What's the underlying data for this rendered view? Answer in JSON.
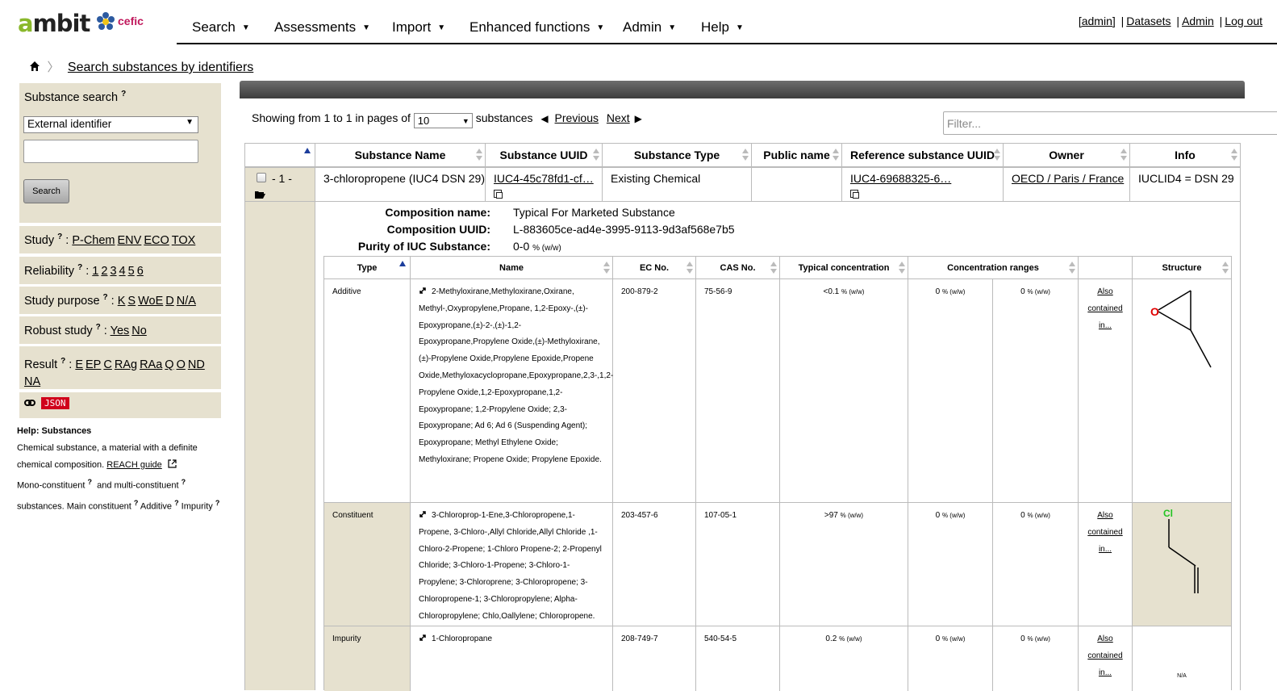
{
  "header": {
    "logo_text": "ambit",
    "logo_sub": "cefic",
    "nav": [
      "Search",
      "Assessments",
      "Import",
      "Enhanced functions",
      "Admin",
      "Help"
    ],
    "user_links": {
      "user": "[admin]",
      "datasets": "Datasets",
      "admin": "Admin",
      "logout": "Log out"
    }
  },
  "breadcrumb": {
    "current": "Search substances by identifiers"
  },
  "sidebar": {
    "search_title": "Substance search",
    "help_mark": "?",
    "select_value": "External identifier",
    "input_value": "",
    "search_button": "Search",
    "study_label": "Study",
    "study_links": [
      "P-Chem",
      "ENV",
      "ECO",
      "TOX"
    ],
    "reliability_label": "Reliability",
    "reliability_links": [
      "1",
      "2",
      "3",
      "4",
      "5",
      "6"
    ],
    "purpose_label": "Study purpose",
    "purpose_links": [
      "K",
      "S",
      "WoE",
      "D",
      "N/A"
    ],
    "robust_label": "Robust study",
    "robust_links": [
      "Yes",
      "No"
    ],
    "result_label": "Result",
    "result_links": [
      "E",
      "EP",
      "C",
      "RAg",
      "RAa",
      "Q",
      "O",
      "ND",
      "NA"
    ],
    "json_badge": "JSON"
  },
  "help": {
    "title": "Help: Substances",
    "line1": "Chemical substance, a material with a definite",
    "line2": "chemical composition.",
    "reach_link": "REACH guide",
    "line3a": "Mono-constituent",
    "line3b": "and multi-constituent",
    "line4a": "substances. Main constituent",
    "line4b": "Additive",
    "line4c": "Impurity"
  },
  "pager": {
    "showing": "Showing from 1 to 1 in pages of",
    "page_size": "10",
    "unit": "substances",
    "previous": "Previous",
    "next": "Next",
    "filter_placeholder": "Filter..."
  },
  "table": {
    "headers": [
      "Substance Name",
      "Substance UUID",
      "Substance Type",
      "Public name",
      "Reference substance UUID",
      "Owner",
      "Info"
    ],
    "row": {
      "index": "- 1 -",
      "name": "3-chloropropene (IUC4 DSN 29)",
      "uuid": "IUC4-45c78fd1-cf…",
      "type": "Existing Chemical",
      "public_name": "",
      "ref_uuid": "IUC4-69688325-6…",
      "owner": "OECD / Paris / France",
      "info": "IUCLID4 = DSN 29"
    }
  },
  "composition": {
    "name_label": "Composition name:",
    "name": "Typical For Marketed Substance",
    "uuid_label": "Composition UUID:",
    "uuid": "L-883605ce-ad4e-3995-9113-9d3af568e7b5",
    "purity_label": "Purity of IUC Substance:",
    "purity": "0-0",
    "purity_unit": "% (w/w)"
  },
  "subtable": {
    "headers": [
      "Type",
      "Name",
      "EC No.",
      "CAS No.",
      "Typical concentration",
      "Concentration ranges",
      "",
      "Structure"
    ],
    "rows": [
      {
        "type": "Additive",
        "name": "2-Methyloxirane,Methyloxirane,Oxirane, Methyl-,Oxypropylene,Propane, 1,2-Epoxy-,(±)-Epoxypropane,(±)-2-,(±)-1,2-Epoxypropane,Propylene Oxide,(±)-Methyloxirane,(±)-Propylene Oxide,Propylene Epoxide,Propene Oxide,Methyloxacyclopropane,Epoxypropane,2,3-,1,2-Propylene Oxide,1,2-Epoxypropane,1,2-Epoxypropane; 1,2-Propylene Oxide; 2,3-Epoxypropane; Ad 6; Ad 6 (Suspending Agent); Epoxypropane; Methyl Ethylene Oxide; Methyloxirane; Propene Oxide; Propylene Epoxide.",
        "ec": "200-879-2",
        "cas": "75-56-9",
        "typical": "<0.1",
        "range_lo": "0",
        "range_hi": "0",
        "unit": "% (w/w)",
        "also": "Also contained in...",
        "structure": "epoxide",
        "atom": "O"
      },
      {
        "type": "Constituent",
        "name": "3-Chloroprop-1-Ene,3-Chloropropene,1-Propene, 3-Chloro-,Allyl Chloride,Allyl Chloride ,1-Chloro-2-Propene; 1-Chloro Propene-2; 2-Propenyl Chloride; 3-Chloro-1-Propene; 3-Chloro-1-Propylene; 3-Chloroprene; 3-Chloropropene; 3-Chloropropene-1; 3-Chloropropylene; Alpha-Chloropropylene; Chlo,Oallylene; Chloropropene.",
        "ec": "203-457-6",
        "cas": "107-05-1",
        "typical": ">97",
        "range_lo": "0",
        "range_hi": "0",
        "unit": "% (w/w)",
        "also": "Also contained in...",
        "structure": "allyl-chloride",
        "atom": "Cl"
      },
      {
        "type": "Impurity",
        "name": "1-Chloropropane",
        "ec": "208-749-7",
        "cas": "540-54-5",
        "typical": "0.2",
        "range_lo": "0",
        "range_hi": "0",
        "unit": "% (w/w)",
        "also": "Also contained in...",
        "structure": "none",
        "structure_text": "N/A"
      }
    ]
  },
  "colors": {
    "sidebar_bg": "#e6e1cf",
    "sort_asc": "#1c3d9c",
    "json_badge": "#d0021b",
    "oxygen": "#e00000",
    "chlorine": "#22c422"
  }
}
